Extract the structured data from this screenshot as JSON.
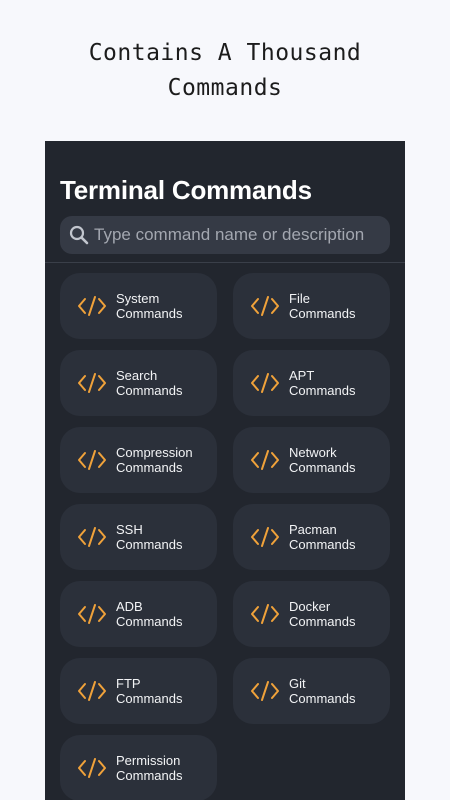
{
  "headline": {
    "line1": "Contains A Thousand",
    "line2": "Commands"
  },
  "app": {
    "title": "Terminal Commands",
    "search": {
      "placeholder": "Type command name or description",
      "value": ""
    }
  },
  "categories": [
    {
      "line1": "System",
      "line2": "Commands"
    },
    {
      "line1": "File",
      "line2": "Commands"
    },
    {
      "line1": "Search",
      "line2": "Commands"
    },
    {
      "line1": "APT",
      "line2": "Commands"
    },
    {
      "line1": "Compression",
      "line2": "Commands"
    },
    {
      "line1": "Network",
      "line2": "Commands"
    },
    {
      "line1": "SSH",
      "line2": "Commands"
    },
    {
      "line1": "Pacman",
      "line2": "Commands"
    },
    {
      "line1": "ADB",
      "line2": "Commands"
    },
    {
      "line1": "Docker",
      "line2": "Commands"
    },
    {
      "line1": "FTP",
      "line2": "Commands"
    },
    {
      "line1": "Git",
      "line2": "Commands"
    },
    {
      "line1": "Permission",
      "line2": "Commands"
    }
  ],
  "icons": {
    "card": "code-icon",
    "search": "search-icon"
  },
  "colors": {
    "accent": "#f0a23a",
    "panel": "#22262e",
    "card": "#2b303a",
    "search_bg": "#353a45"
  }
}
